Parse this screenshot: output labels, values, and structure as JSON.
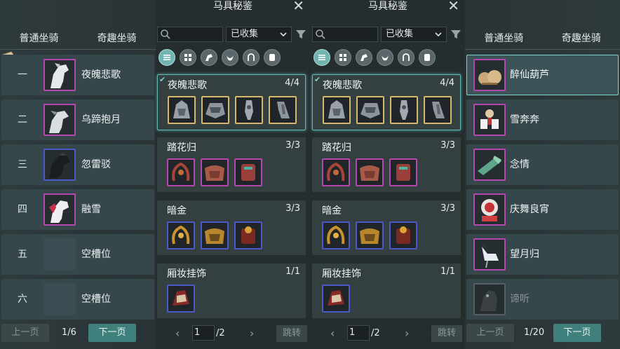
{
  "left": {
    "tabs": [
      "普通坐骑",
      "奇趣坐骑"
    ],
    "slots": [
      {
        "num": "一",
        "name": "夜魄悲歌",
        "icon": "white-horse-icon",
        "filled": true
      },
      {
        "num": "二",
        "name": "乌蹄抱月",
        "icon": "white-horse-icon",
        "filled": true
      },
      {
        "num": "三",
        "name": "忽雷驳",
        "icon": "black-horse-icon",
        "filled": true
      },
      {
        "num": "四",
        "name": "融雪",
        "icon": "red-mane-horse-icon",
        "filled": true
      },
      {
        "num": "五",
        "name": "空槽位",
        "icon": "empty-slot-icon",
        "filled": false
      },
      {
        "num": "六",
        "name": "空槽位",
        "icon": "empty-slot-icon",
        "filled": false
      }
    ],
    "pager": {
      "prev": "上一页",
      "page": "1/6",
      "next": "下一页"
    }
  },
  "panels": [
    {
      "title": "马具秘鉴",
      "filter_value": "已收集",
      "sets": [
        {
          "name": "夜魄悲歌",
          "count": "4/4"
        },
        {
          "name": "踏花归",
          "count": "3/3"
        },
        {
          "name": "暗金",
          "count": "3/3"
        },
        {
          "name": "厢妆挂饰",
          "count": "1/1"
        }
      ],
      "pager": {
        "page": "1",
        "total": "/2",
        "jump": "跳转"
      }
    },
    {
      "title": "马具秘鉴",
      "filter_value": "已收集",
      "sets": [
        {
          "name": "夜魄悲歌",
          "count": "4/4"
        },
        {
          "name": "踏花归",
          "count": "3/3"
        },
        {
          "name": "暗金",
          "count": "3/3"
        },
        {
          "name": "厢妆挂饰",
          "count": "1/1"
        }
      ],
      "pager": {
        "page": "1",
        "total": "/2",
        "jump": "跳转"
      }
    }
  ],
  "right": {
    "tabs": [
      "普通坐骑",
      "奇趣坐骑"
    ],
    "slots": [
      {
        "name": "醉仙葫芦",
        "icon": "gourd-mount-icon"
      },
      {
        "name": "雪奔奔",
        "icon": "sled-dogs-icon"
      },
      {
        "name": "念情",
        "icon": "jade-scroll-icon"
      },
      {
        "name": "庆舞良宵",
        "icon": "lion-dance-icon"
      },
      {
        "name": "望月归",
        "icon": "crane-mount-icon"
      },
      {
        "name": "谛听",
        "icon": "beast-mount-icon"
      }
    ],
    "pager": {
      "prev": "上一页",
      "page": "1/20",
      "next": "下一页"
    }
  },
  "colors": {
    "accent": "#3f7f7c",
    "rare": "#b548b0",
    "epic": "#d6b76b",
    "blue": "#4a5ac9"
  }
}
